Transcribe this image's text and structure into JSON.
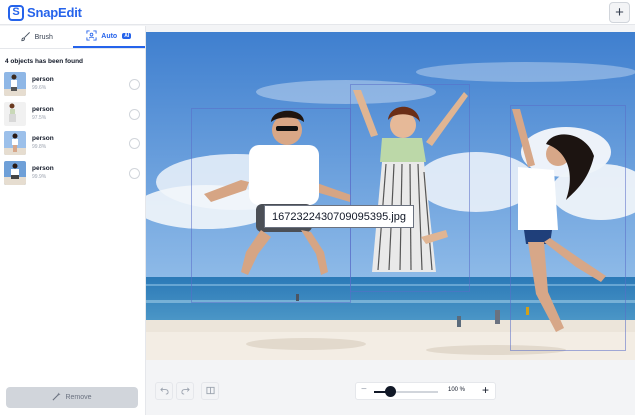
{
  "app": {
    "name": "SnapEdit"
  },
  "header": {
    "add_label": "+"
  },
  "tabs": [
    {
      "label": "Brush",
      "icon": "brush-icon",
      "active": false
    },
    {
      "label": "Auto",
      "icon": "auto-detect-icon",
      "badge": "AI",
      "active": true
    }
  ],
  "detection": {
    "summary": "4 objects has been found",
    "objects": [
      {
        "name": "person",
        "confidence": "99.6%"
      },
      {
        "name": "person",
        "confidence": "97.5%"
      },
      {
        "name": "person",
        "confidence": "99.8%"
      },
      {
        "name": "person",
        "confidence": "99.9%"
      }
    ]
  },
  "remove_button": {
    "label": "Remove",
    "icon": "magic-wand-icon"
  },
  "canvas": {
    "filename_tooltip": "1672322430709095395.jpg"
  },
  "toolbar": {
    "undo_icon": "undo-icon",
    "redo_icon": "redo-icon",
    "compare_icon": "compare-icon",
    "zoom_minus": "−",
    "zoom_plus": "+",
    "zoom_value": "100 %",
    "zoom_level": 0.25
  },
  "colors": {
    "accent": "#2563eb",
    "sky": "#4f8fd6",
    "sea": "#2f7fb8",
    "sand": "#e9e2d6"
  }
}
